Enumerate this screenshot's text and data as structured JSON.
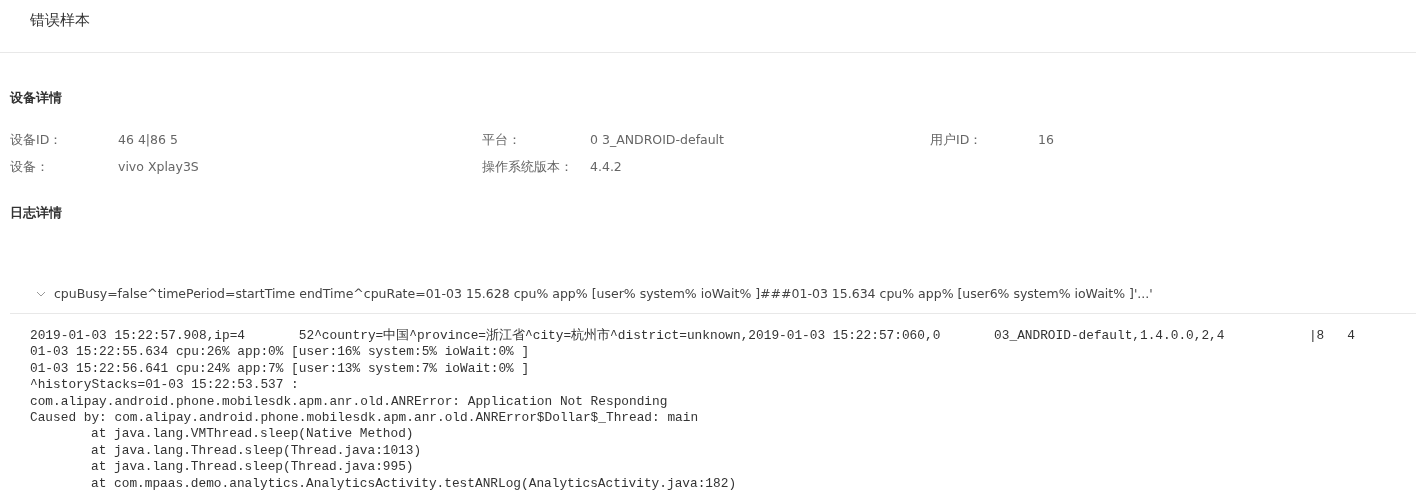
{
  "page_title": "错误样本",
  "device_section": {
    "title": "设备详情",
    "fields": [
      {
        "label": "设备ID：",
        "value": "46 4|86 5"
      },
      {
        "label": "平台：",
        "value": "0 3_ANDROID-default"
      },
      {
        "label": "用户ID：",
        "value": "16"
      },
      {
        "label": "设备：",
        "value": "vivo Xplay3S"
      },
      {
        "label": "操作系统版本：",
        "value": "4.4.2"
      }
    ]
  },
  "log_section": {
    "title": "日志详情",
    "entry": {
      "summary": "cpuBusy=false^timePeriod=startTime endTime^cpuRate=01-03 15.628 cpu% app% [user% system% ioWait% ]###01-03 15.634 cpu% app% [user6% system% ioWait% ]'...'",
      "expanded": true,
      "lines": [
        {
          "text": "2019-01-03 15:22:57.908,ip=4       52^country=中国^province=浙江省^city=杭州市^district=unknown,2019-01-03 15:22:57:060,0       03_ANDROID-default,1.4.0.0,2,4           |8   4",
          "indented": false
        },
        {
          "text": "01-03 15:22:55.634 cpu:26% app:0% [user:16% system:5% ioWait:0% ]",
          "indented": false
        },
        {
          "text": "01-03 15:22:56.641 cpu:24% app:7% [user:13% system:7% ioWait:0% ]",
          "indented": false
        },
        {
          "text": "^historyStacks=01-03 15:22:53.537 :",
          "indented": false
        },
        {
          "text": "com.alipay.android.phone.mobilesdk.apm.anr.old.ANRError: Application Not Responding",
          "indented": false
        },
        {
          "text": "Caused by: com.alipay.android.phone.mobilesdk.apm.anr.old.ANRError$Dollar$_Thread: main",
          "indented": false
        },
        {
          "text": "at java.lang.VMThread.sleep(Native Method)",
          "indented": true
        },
        {
          "text": "at java.lang.Thread.sleep(Thread.java:1013)",
          "indented": true
        },
        {
          "text": "at java.lang.Thread.sleep(Thread.java:995)",
          "indented": true
        },
        {
          "text": "at com.mpaas.demo.analytics.AnalyticsActivity.testANRLog(AnalyticsActivity.java:182)",
          "indented": true
        }
      ]
    }
  }
}
